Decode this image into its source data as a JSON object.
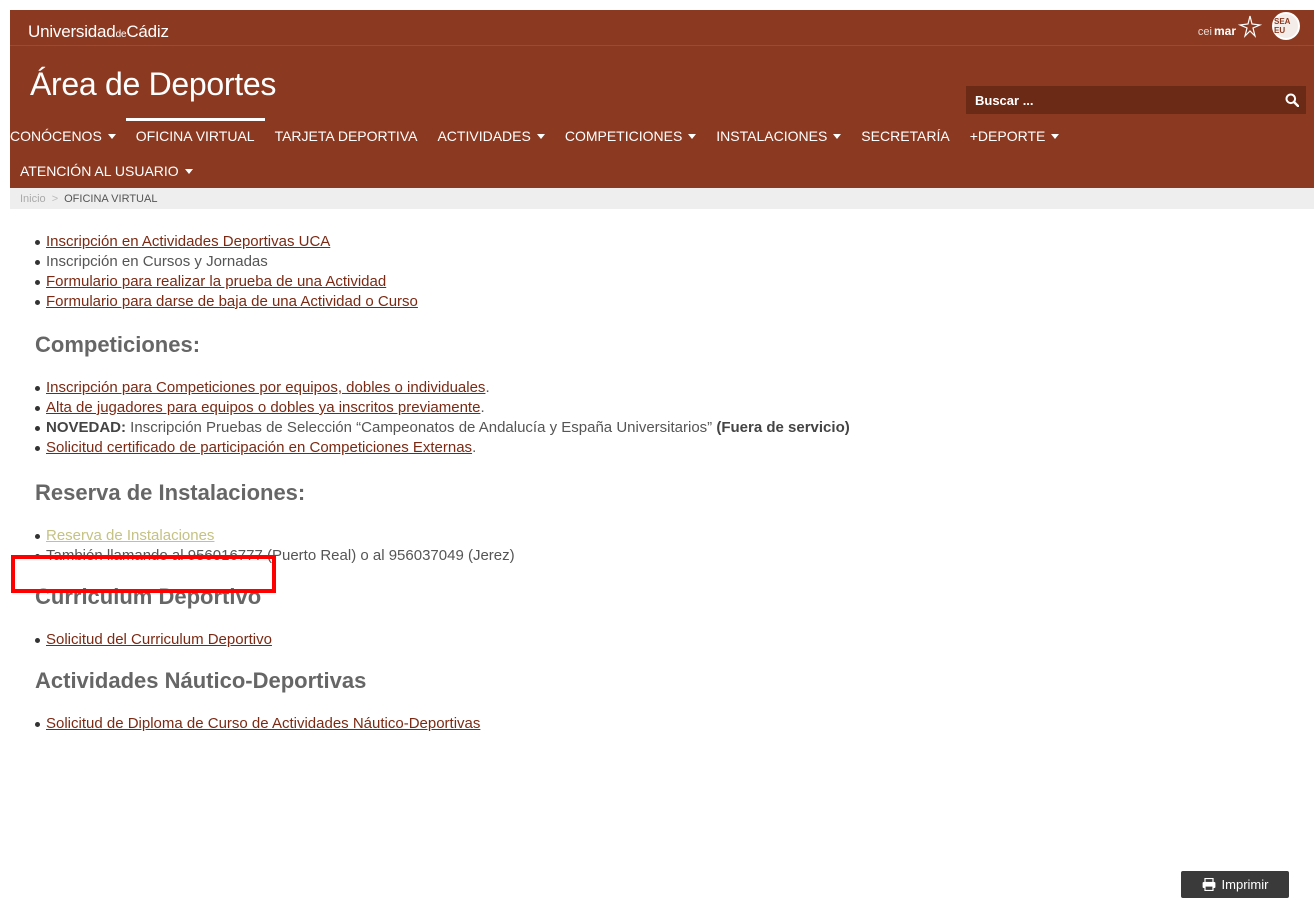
{
  "header": {
    "brand_a": "Universidad",
    "brand_b": "de",
    "brand_c": "Cádiz",
    "ceimar_a": "cei",
    "ceimar_b": "mar",
    "seal_text": "SEA EU",
    "site_title": "Área de Deportes",
    "search_placeholder": "Buscar ..."
  },
  "nav": {
    "row1": [
      {
        "label": "CONÓCENOS",
        "dropdown": true
      },
      {
        "label": "OFICINA VIRTUAL",
        "dropdown": false,
        "active": true
      },
      {
        "label": "TARJETA DEPORTIVA",
        "dropdown": false
      },
      {
        "label": "ACTIVIDADES",
        "dropdown": true
      },
      {
        "label": "COMPETICIONES",
        "dropdown": true
      },
      {
        "label": "INSTALACIONES",
        "dropdown": true
      },
      {
        "label": "SECRETARÍA",
        "dropdown": false
      },
      {
        "label": "+DEPORTE",
        "dropdown": true
      }
    ],
    "row2": [
      {
        "label": "ATENCIÓN AL USUARIO",
        "dropdown": true
      }
    ]
  },
  "breadcrumb": {
    "home": "Inicio",
    "separator": ">",
    "current": "OFICINA VIRTUAL"
  },
  "sections": {
    "activities": {
      "items": [
        "Inscripción en Actividades Deportivas UCA",
        "Inscripción en Cursos y Jornadas",
        "Formulario para realizar la prueba de una Actividad",
        "Formulario para darse de baja de una Actividad o Curso"
      ]
    },
    "competitions": {
      "title": "Competiciones:",
      "item1_link": "Inscripción para Competiciones por equipos, dobles o individuales",
      "item2_link": "Alta de jugadores para equipos o dobles ya inscritos previamente",
      "item3_strong": "NOVEDAD:",
      "item3_text": " Inscripción Pruebas de Selección “Campeonatos de Andalucía y España Universitarios” ",
      "item3_note": "(Fuera de servicio)",
      "item4_link": "Solicitud certificado de participación en Competiciones Externas",
      "period": "."
    },
    "reservations": {
      "title": "Reserva de Instalaciones:",
      "item1_link": "Reserva de Instalaciones",
      "item2_text": "También llamando al 956016777 (Puerto Real) o al 956037049 (Jerez)"
    },
    "curriculum": {
      "title": "Curriculum Deportivo",
      "item1_link": "Solicitud del Curriculum Deportivo"
    },
    "nautical": {
      "title": "Actividades Náutico-Deportivas",
      "item1_link": "Solicitud de Diploma de Curso de Actividades Náutico-Deportivas"
    }
  },
  "print_label": "Imprimir",
  "colors": {
    "brand": "#8b3a21",
    "link": "#7a2a14",
    "visited_link": "#c4c284",
    "highlight": "#ff0000"
  }
}
